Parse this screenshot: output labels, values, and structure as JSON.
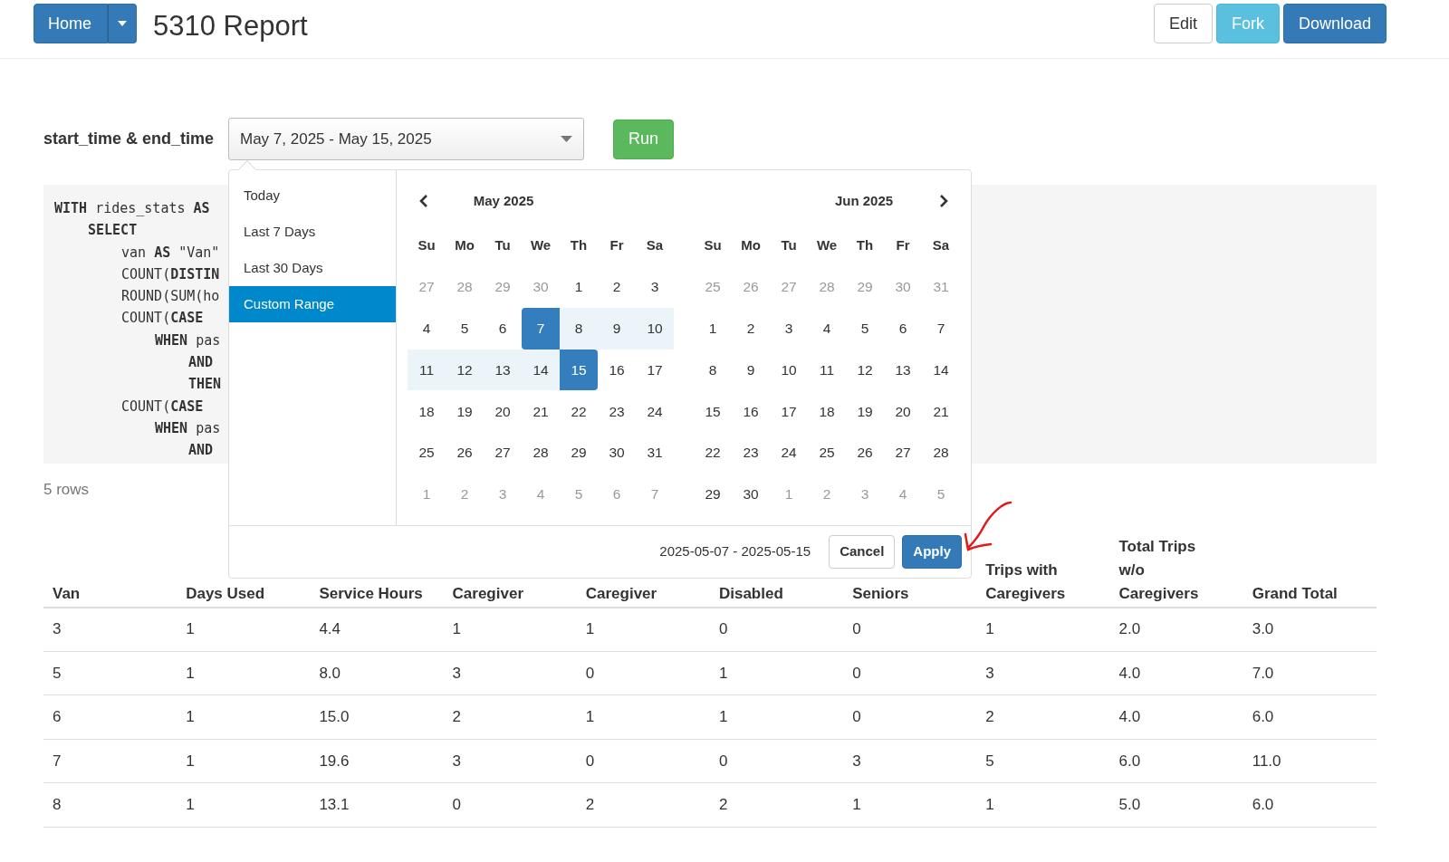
{
  "header": {
    "home_button": "Home",
    "title": "5310 Report",
    "actions": [
      {
        "label": "Edit",
        "kind": "default"
      },
      {
        "label": "Fork",
        "kind": "info"
      },
      {
        "label": "Download",
        "kind": "primary"
      }
    ]
  },
  "parameter": {
    "label": "start_time & end_time",
    "value": "May 7, 2025 - May 15, 2025",
    "run_button": "Run"
  },
  "sql": [
    {
      "text": "**WITH** rides_stats **AS**",
      "children": [
        {
          "text": "**SELECT**",
          "children": [
            {
              "text": "van **AS** \"Van\""
            },
            {
              "text": "COUNT(**DISTIN**"
            },
            {
              "text": "ROUND(SUM(ho"
            },
            {
              "text": "COUNT(**CASE**",
              "children": [
                {
                  "text": "**WHEN** pas",
                  "children": [
                    {
                      "text": "**AND**"
                    },
                    {
                      "text": "**THEN**"
                    }
                  ]
                }
              ]
            },
            {
              "text": "COUNT(**CASE**",
              "children": [
                {
                  "text": "**WHEN** pas",
                  "children": [
                    {
                      "text": "**AND**"
                    }
                  ]
                }
              ]
            }
          ]
        }
      ]
    }
  ],
  "row_count": "5 rows",
  "date_picker": {
    "ranges": [
      {
        "label": "Today",
        "selected": false
      },
      {
        "label": "Last 7 Days",
        "selected": false
      },
      {
        "label": "Last 30 Days",
        "selected": false
      },
      {
        "label": "Custom Range",
        "selected": true
      }
    ],
    "months": [
      {
        "title": "May 2025",
        "weekdays": [
          "Su",
          "Mo",
          "Tu",
          "We",
          "Th",
          "Fr",
          "Sa"
        ],
        "weeks": [
          [
            {
              "text": "27",
              "off": true,
              "selected": false,
              "in_range": false
            },
            {
              "text": "28",
              "off": true,
              "selected": false,
              "in_range": false
            },
            {
              "text": "29",
              "off": true,
              "selected": false,
              "in_range": false
            },
            {
              "text": "30",
              "off": true,
              "selected": false,
              "in_range": false
            },
            {
              "text": "1",
              "off": false,
              "selected": false,
              "in_range": false
            },
            {
              "text": "2",
              "off": false,
              "selected": false,
              "in_range": false
            },
            {
              "text": "3",
              "off": false,
              "selected": false,
              "in_range": false
            }
          ],
          [
            {
              "text": "4",
              "off": false,
              "selected": false,
              "in_range": false
            },
            {
              "text": "5",
              "off": false,
              "selected": false,
              "in_range": false
            },
            {
              "text": "6",
              "off": false,
              "selected": false,
              "in_range": false
            },
            {
              "text": "7",
              "off": false,
              "selected": true,
              "in_range": true
            },
            {
              "text": "8",
              "off": false,
              "selected": false,
              "in_range": true
            },
            {
              "text": "9",
              "off": false,
              "selected": false,
              "in_range": true
            },
            {
              "text": "10",
              "off": false,
              "selected": false,
              "in_range": true
            }
          ],
          [
            {
              "text": "11",
              "off": false,
              "selected": false,
              "in_range": true
            },
            {
              "text": "12",
              "off": false,
              "selected": false,
              "in_range": true
            },
            {
              "text": "13",
              "off": false,
              "selected": false,
              "in_range": true
            },
            {
              "text": "14",
              "off": false,
              "selected": false,
              "in_range": true
            },
            {
              "text": "15",
              "off": false,
              "selected": true,
              "in_range": true
            },
            {
              "text": "16",
              "off": false,
              "selected": false,
              "in_range": false
            },
            {
              "text": "17",
              "off": false,
              "selected": false,
              "in_range": false
            }
          ],
          [
            {
              "text": "18",
              "off": false,
              "selected": false,
              "in_range": false
            },
            {
              "text": "19",
              "off": false,
              "selected": false,
              "in_range": false
            },
            {
              "text": "20",
              "off": false,
              "selected": false,
              "in_range": false
            },
            {
              "text": "21",
              "off": false,
              "selected": false,
              "in_range": false
            },
            {
              "text": "22",
              "off": false,
              "selected": false,
              "in_range": false
            },
            {
              "text": "23",
              "off": false,
              "selected": false,
              "in_range": false
            },
            {
              "text": "24",
              "off": false,
              "selected": false,
              "in_range": false
            }
          ],
          [
            {
              "text": "25",
              "off": false,
              "selected": false,
              "in_range": false
            },
            {
              "text": "26",
              "off": false,
              "selected": false,
              "in_range": false
            },
            {
              "text": "27",
              "off": false,
              "selected": false,
              "in_range": false
            },
            {
              "text": "28",
              "off": false,
              "selected": false,
              "in_range": false
            },
            {
              "text": "29",
              "off": false,
              "selected": false,
              "in_range": false
            },
            {
              "text": "30",
              "off": false,
              "selected": false,
              "in_range": false
            },
            {
              "text": "31",
              "off": false,
              "selected": false,
              "in_range": false
            }
          ],
          [
            {
              "text": "1",
              "off": true,
              "selected": false,
              "in_range": false
            },
            {
              "text": "2",
              "off": true,
              "selected": false,
              "in_range": false
            },
            {
              "text": "3",
              "off": true,
              "selected": false,
              "in_range": false
            },
            {
              "text": "4",
              "off": true,
              "selected": false,
              "in_range": false
            },
            {
              "text": "5",
              "off": true,
              "selected": false,
              "in_range": false
            },
            {
              "text": "6",
              "off": true,
              "selected": false,
              "in_range": false
            },
            {
              "text": "7",
              "off": true,
              "selected": false,
              "in_range": false
            }
          ]
        ]
      },
      {
        "title": "Jun 2025",
        "weekdays": [
          "Su",
          "Mo",
          "Tu",
          "We",
          "Th",
          "Fr",
          "Sa"
        ],
        "weeks": [
          [
            {
              "text": "25",
              "off": true,
              "selected": false,
              "in_range": false
            },
            {
              "text": "26",
              "off": true,
              "selected": false,
              "in_range": false
            },
            {
              "text": "27",
              "off": true,
              "selected": false,
              "in_range": false
            },
            {
              "text": "28",
              "off": true,
              "selected": false,
              "in_range": false
            },
            {
              "text": "29",
              "off": true,
              "selected": false,
              "in_range": false
            },
            {
              "text": "30",
              "off": true,
              "selected": false,
              "in_range": false
            },
            {
              "text": "31",
              "off": true,
              "selected": false,
              "in_range": false
            }
          ],
          [
            {
              "text": "1",
              "off": false,
              "selected": false,
              "in_range": false
            },
            {
              "text": "2",
              "off": false,
              "selected": false,
              "in_range": false
            },
            {
              "text": "3",
              "off": false,
              "selected": false,
              "in_range": false
            },
            {
              "text": "4",
              "off": false,
              "selected": false,
              "in_range": false
            },
            {
              "text": "5",
              "off": false,
              "selected": false,
              "in_range": false
            },
            {
              "text": "6",
              "off": false,
              "selected": false,
              "in_range": false
            },
            {
              "text": "7",
              "off": false,
              "selected": false,
              "in_range": false
            }
          ],
          [
            {
              "text": "8",
              "off": false,
              "selected": false,
              "in_range": false
            },
            {
              "text": "9",
              "off": false,
              "selected": false,
              "in_range": false
            },
            {
              "text": "10",
              "off": false,
              "selected": false,
              "in_range": false
            },
            {
              "text": "11",
              "off": false,
              "selected": false,
              "in_range": false
            },
            {
              "text": "12",
              "off": false,
              "selected": false,
              "in_range": false
            },
            {
              "text": "13",
              "off": false,
              "selected": false,
              "in_range": false
            },
            {
              "text": "14",
              "off": false,
              "selected": false,
              "in_range": false
            }
          ],
          [
            {
              "text": "15",
              "off": false,
              "selected": false,
              "in_range": false
            },
            {
              "text": "16",
              "off": false,
              "selected": false,
              "in_range": false
            },
            {
              "text": "17",
              "off": false,
              "selected": false,
              "in_range": false
            },
            {
              "text": "18",
              "off": false,
              "selected": false,
              "in_range": false
            },
            {
              "text": "19",
              "off": false,
              "selected": false,
              "in_range": false
            },
            {
              "text": "20",
              "off": false,
              "selected": false,
              "in_range": false
            },
            {
              "text": "21",
              "off": false,
              "selected": false,
              "in_range": false
            }
          ],
          [
            {
              "text": "22",
              "off": false,
              "selected": false,
              "in_range": false
            },
            {
              "text": "23",
              "off": false,
              "selected": false,
              "in_range": false
            },
            {
              "text": "24",
              "off": false,
              "selected": false,
              "in_range": false
            },
            {
              "text": "25",
              "off": false,
              "selected": false,
              "in_range": false
            },
            {
              "text": "26",
              "off": false,
              "selected": false,
              "in_range": false
            },
            {
              "text": "27",
              "off": false,
              "selected": false,
              "in_range": false
            },
            {
              "text": "28",
              "off": false,
              "selected": false,
              "in_range": false
            }
          ],
          [
            {
              "text": "29",
              "off": false,
              "selected": false,
              "in_range": false
            },
            {
              "text": "30",
              "off": false,
              "selected": false,
              "in_range": false
            },
            {
              "text": "1",
              "off": true,
              "selected": false,
              "in_range": false
            },
            {
              "text": "2",
              "off": true,
              "selected": false,
              "in_range": false
            },
            {
              "text": "3",
              "off": true,
              "selected": false,
              "in_range": false
            },
            {
              "text": "4",
              "off": true,
              "selected": false,
              "in_range": false
            },
            {
              "text": "5",
              "off": true,
              "selected": false,
              "in_range": false
            }
          ]
        ]
      }
    ],
    "selection_text": "2025-05-07 - 2025-05-15",
    "cancel_button": "Cancel",
    "apply_button": "Apply"
  },
  "table": {
    "columns": [
      "Van",
      "Days Used",
      "Service Hours",
      "Caregiver",
      "Caregiver",
      "Disabled",
      "Seniors",
      "Trips with Caregivers",
      "Total Trips w/o Caregivers",
      "Grand Total"
    ],
    "rows": [
      [
        "3",
        "1",
        "4.4",
        "1",
        "1",
        "0",
        "0",
        "1",
        "2.0",
        "3.0"
      ],
      [
        "5",
        "1",
        "8.0",
        "3",
        "0",
        "1",
        "0",
        "3",
        "4.0",
        "7.0"
      ],
      [
        "6",
        "1",
        "15.0",
        "2",
        "1",
        "1",
        "0",
        "2",
        "4.0",
        "6.0"
      ],
      [
        "7",
        "1",
        "19.6",
        "3",
        "0",
        "0",
        "3",
        "5",
        "6.0",
        "11.0"
      ],
      [
        "8",
        "1",
        "13.1",
        "0",
        "2",
        "2",
        "1",
        "1",
        "5.0",
        "6.0"
      ]
    ]
  }
}
